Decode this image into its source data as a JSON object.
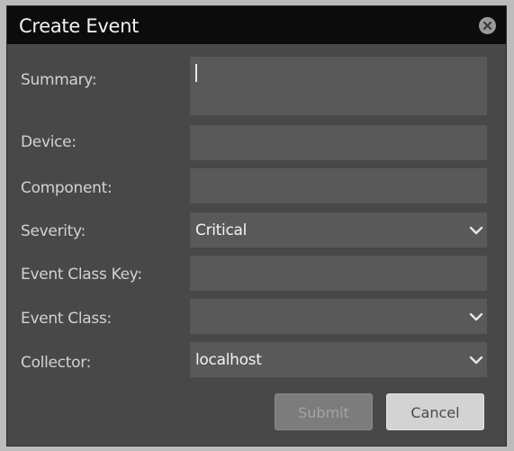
{
  "dialog": {
    "title": "Create Event",
    "close_icon": "close-circle-icon"
  },
  "form": {
    "summary": {
      "label": "Summary:",
      "value": ""
    },
    "device": {
      "label": "Device:",
      "value": ""
    },
    "component": {
      "label": "Component:",
      "value": ""
    },
    "severity": {
      "label": "Severity:",
      "selected": "Critical"
    },
    "event_class_key": {
      "label": "Event Class Key:",
      "value": ""
    },
    "event_class": {
      "label": "Event Class:",
      "selected": ""
    },
    "collector": {
      "label": "Collector:",
      "selected": "localhost"
    }
  },
  "buttons": {
    "submit_label": "Submit",
    "cancel_label": "Cancel"
  },
  "colors": {
    "titlebar": "#0c0c0c",
    "dialog_body": "#484848",
    "field_bg": "#595959",
    "frame": "#bcbcbc"
  }
}
